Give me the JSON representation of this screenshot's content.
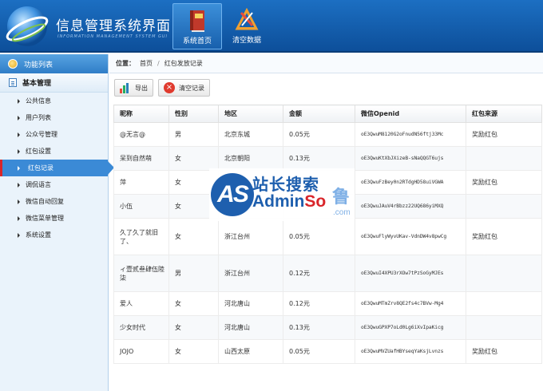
{
  "header": {
    "title": "信息管理系统界面",
    "subtitle": "INFORMATION MANAGEMENT SYSTEM GUI",
    "nav": [
      {
        "label": "系统首页",
        "icon": "book-icon"
      },
      {
        "label": "清空数据",
        "icon": "clear-data-icon"
      }
    ]
  },
  "sidebar": {
    "heading": "功能列表",
    "group": "基本管理",
    "items": [
      {
        "label": "公共信息"
      },
      {
        "label": "用户列表"
      },
      {
        "label": "公众号管理"
      },
      {
        "label": "红包设置"
      },
      {
        "label": "红包记录"
      },
      {
        "label": "调侃语言"
      },
      {
        "label": "微信自动回复"
      },
      {
        "label": "微信菜单管理"
      },
      {
        "label": "系统设置"
      }
    ],
    "active_index": 4
  },
  "breadcrumb": {
    "label": "位置：",
    "home": "首页",
    "separator": "/",
    "current": "红包发放记录"
  },
  "toolbar": {
    "export_label": "导出",
    "clear_label": "清空记录"
  },
  "table": {
    "columns": [
      "昵称",
      "性别",
      "地区",
      "金额",
      "微信Openid",
      "红包来源"
    ],
    "rows": [
      [
        "@无言@",
        "男",
        "北京东城",
        "0.05元",
        "oE3QwuM8120G2oFnudN56ftj33Mc",
        "奖励红包"
      ],
      [
        "呆到自然萌",
        "女",
        "北京朝阳",
        "0.13元",
        "oE3QwuKtXbJXizeB-sNaQQGT6ujs",
        ""
      ],
      [
        "萍",
        "女",
        "",
        "",
        "oE3QwuFzBey0n2RTdgHD58uiVGWA",
        "奖励红包"
      ],
      [
        "小伍",
        "女",
        "",
        "",
        "oE3QwuJAuV4rBbzz22UQ686yiMXQ",
        ""
      ],
      [
        "久了久了就旧了、",
        "女",
        "浙江台州",
        "0.05元",
        "oE3QwuFlyWyvUKav-VdnDW4v8pwCg",
        "奖励红包"
      ],
      [
        "ィ壹贰叁肆伍陸柒",
        "男",
        "浙江台州",
        "0.12元",
        "oE3QwuI4XPU3rXOw7tPzSoGyMJEs",
        ""
      ],
      [
        "爱人",
        "女",
        "河北唐山",
        "0.12元",
        "oE3QwuMTmZrv8QE2fs4c7BVw-Mg4",
        ""
      ],
      [
        "少女时代",
        "女",
        "河北唐山",
        "0.13元",
        "oE3QwuGPXP7oLd0Lg6iXvIpaKicg",
        ""
      ],
      [
        "JOJO",
        "女",
        "山西太原",
        "0.05元",
        "oE3QwuMVZUafHBYseqYaKsjLvnzs",
        "奖励红包"
      ]
    ],
    "row_sizes": [
      "s",
      "s",
      "s",
      "s",
      "l",
      "l",
      "s",
      "s",
      "s"
    ]
  },
  "watermark": {
    "badge": "AS",
    "top_text": "站长搜索",
    "brand_a": "Admin",
    "brand_b": "So",
    "side_char": "鲁",
    "com": ".com"
  }
}
